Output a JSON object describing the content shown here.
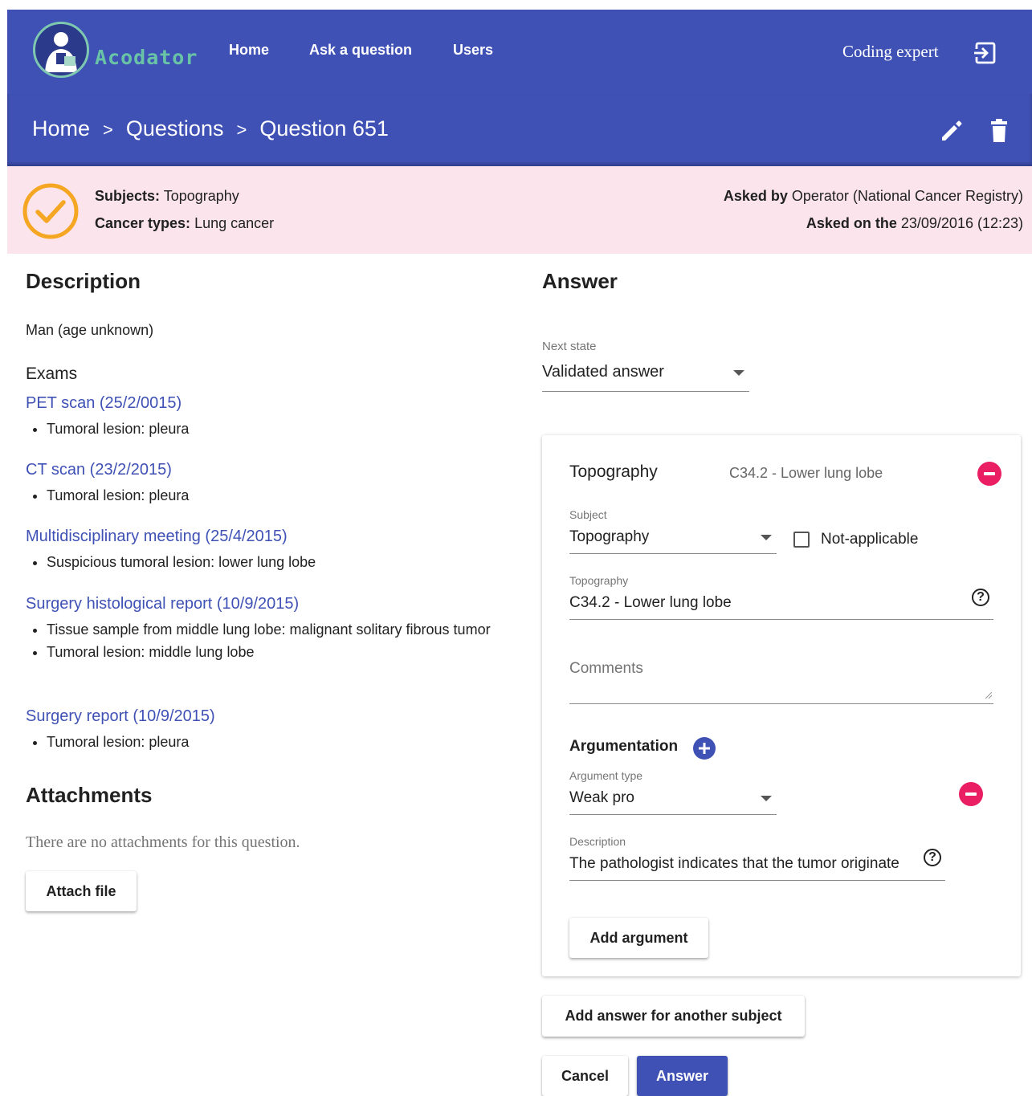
{
  "header": {
    "logo_text": "Acodator",
    "nav": [
      "Home",
      "Ask a question",
      "Users"
    ],
    "user_name": "Coding expert"
  },
  "breadcrumb": [
    "Home",
    "Questions",
    "Question 651"
  ],
  "banner": {
    "subjects_label": "Subjects:",
    "subjects_value": "Topography",
    "cancer_types_label": "Cancer types:",
    "cancer_types_value": "Lung cancer",
    "asked_by_label": "Asked by",
    "asked_by_value": "Operator (National Cancer Registry)",
    "asked_on_label": "Asked on the",
    "asked_on_value": "23/09/2016 (12:23)",
    "status_color": "#f5a623"
  },
  "description": {
    "title": "Description",
    "patient": "Man (age unknown)",
    "exams_title": "Exams",
    "exams": [
      {
        "title": "PET scan (25/2/0015)",
        "findings": [
          "Tumoral lesion: pleura"
        ]
      },
      {
        "title": "CT scan (23/2/2015)",
        "findings": [
          "Tumoral lesion: pleura"
        ]
      },
      {
        "title": "Multidisciplinary meeting (25/4/2015)",
        "findings": [
          "Suspicious tumoral lesion: lower lung lobe"
        ]
      },
      {
        "title": "Surgery histological report (10/9/2015)",
        "findings": [
          "Tissue sample from middle lung lobe: malignant solitary fibrous tumor",
          "Tumoral lesion: middle lung lobe"
        ]
      },
      {
        "title": "Surgery report (10/9/2015)",
        "findings": [
          "Tumoral lesion: pleura"
        ]
      }
    ]
  },
  "attachments": {
    "title": "Attachments",
    "empty_text": "There are no attachments for this question.",
    "attach_button": "Attach file"
  },
  "answer": {
    "title": "Answer",
    "next_state_label": "Next state",
    "next_state_value": "Validated answer",
    "card": {
      "heading": "Topography",
      "code_summary": "C34.2 - Lower lung lobe",
      "subject_label": "Subject",
      "subject_value": "Topography",
      "not_applicable_label": "Not-applicable",
      "topography_label": "Topography",
      "topography_value": "C34.2 - Lower lung lobe",
      "comments_placeholder": "Comments",
      "argumentation_label": "Argumentation",
      "argument_type_label": "Argument type",
      "argument_type_value": "Weak pro",
      "arg_description_label": "Description",
      "arg_description_value": "The pathologist indicates that the tumor originate",
      "add_argument_button": "Add argument"
    },
    "add_subject_button": "Add answer for another subject",
    "cancel_button": "Cancel",
    "answer_button": "Answer"
  }
}
